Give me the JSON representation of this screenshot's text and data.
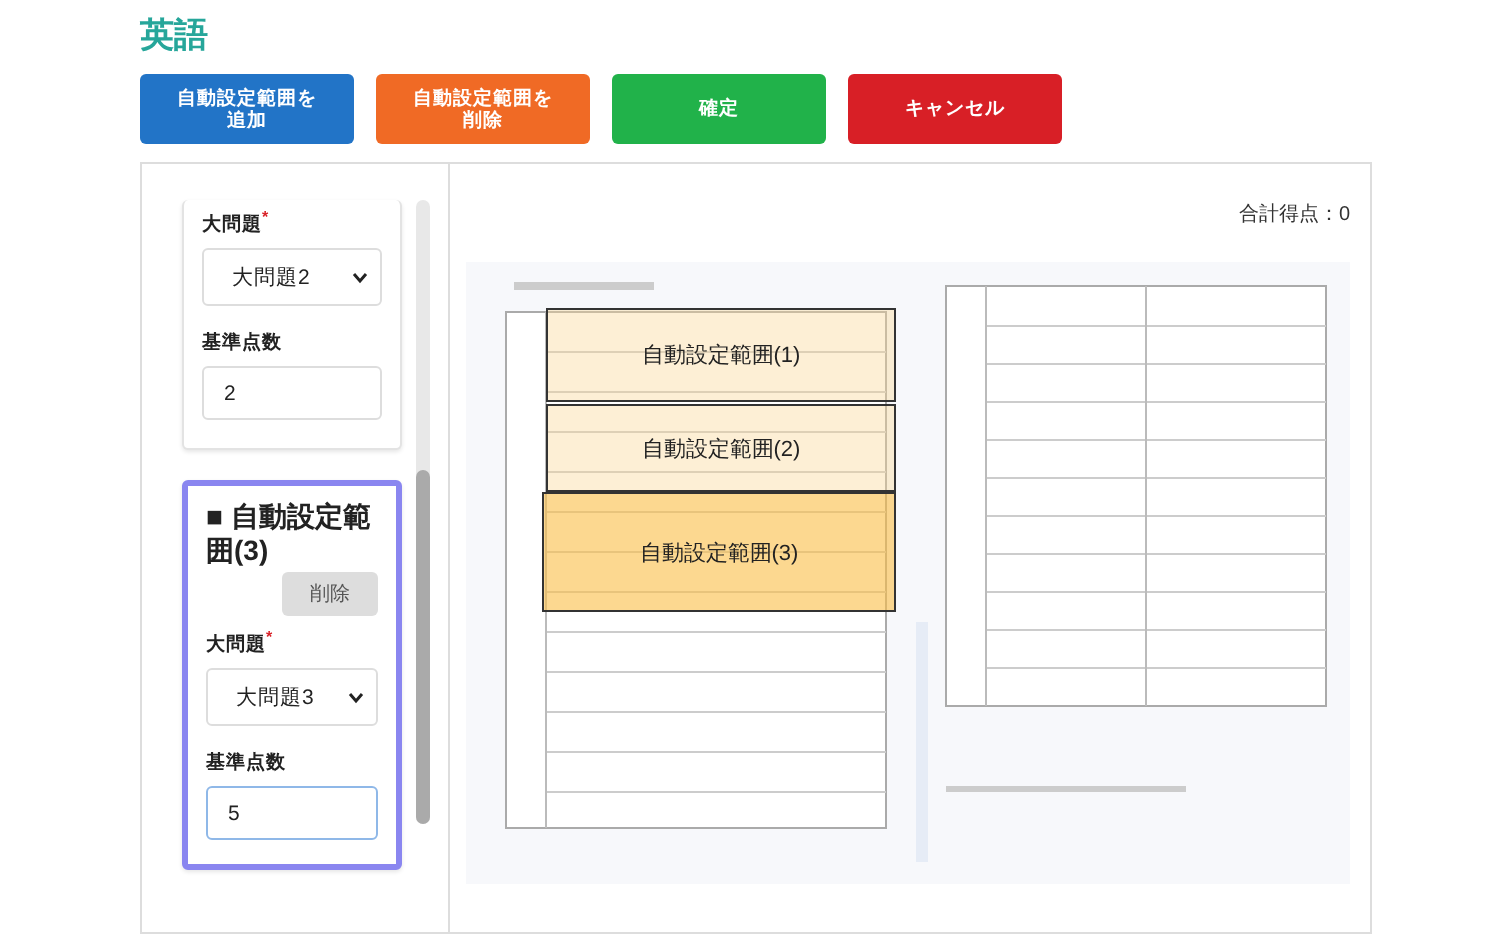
{
  "page_title": "英語",
  "buttons": [
    {
      "label": "自動設定範囲を追加",
      "kind": "add"
    },
    {
      "label": "自動設定範囲を削除",
      "kind": "remove"
    },
    {
      "label": "確定",
      "kind": "confirm"
    },
    {
      "label": "キャンセル",
      "kind": "cancel"
    }
  ],
  "ranges": [
    {
      "major_label": "大問題",
      "required_mark": "*",
      "major_value": "大問題2",
      "score_label": "基準点数",
      "score_value": "2",
      "selected": false
    },
    {
      "title": "■ 自動設定範囲(3)",
      "delete_label": "削除",
      "major_label": "大問題",
      "required_mark": "*",
      "major_value": "大問題3",
      "score_label": "基準点数",
      "score_value": "5",
      "selected": true
    }
  ],
  "total_score": "合計得点：0",
  "overlays": [
    {
      "label": "自動設定範囲(1)",
      "selected": false
    },
    {
      "label": "自動設定範囲(2)",
      "selected": false
    },
    {
      "label": "自動設定範囲(3)",
      "selected": true
    }
  ]
}
